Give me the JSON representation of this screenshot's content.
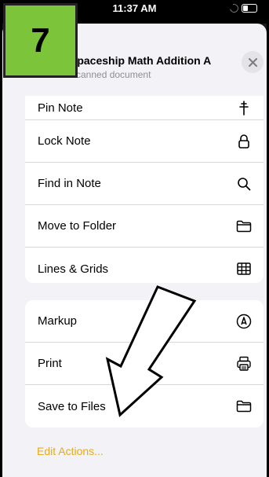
{
  "status_bar": {
    "time": "11:37 AM"
  },
  "header": {
    "title": "Spaceship Math Addition A",
    "subtitle": "Scanned document"
  },
  "menu_group_1": [
    {
      "label": "Pin Note",
      "icon": "pin-icon"
    },
    {
      "label": "Lock Note",
      "icon": "lock-icon"
    },
    {
      "label": "Find in Note",
      "icon": "search-icon"
    },
    {
      "label": "Move to Folder",
      "icon": "folder-icon"
    },
    {
      "label": "Lines & Grids",
      "icon": "grid-icon"
    }
  ],
  "menu_group_2": [
    {
      "label": "Markup",
      "icon": "markup-icon"
    },
    {
      "label": "Print",
      "icon": "printer-icon"
    },
    {
      "label": "Save to Files",
      "icon": "folder-icon"
    }
  ],
  "edit_actions_label": "Edit Actions...",
  "step_badge": "7",
  "colors": {
    "accent": "#e5ac1b",
    "badge": "#7cc43a"
  }
}
